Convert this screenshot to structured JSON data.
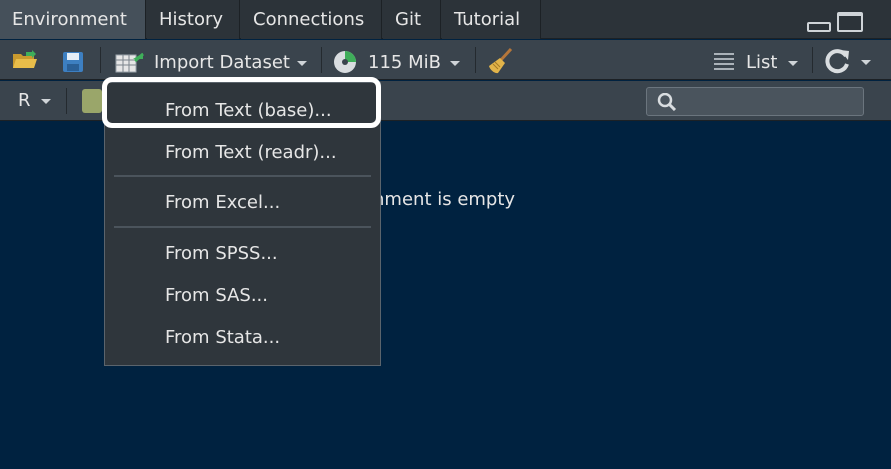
{
  "tabs": [
    {
      "label": "Environment",
      "active": true
    },
    {
      "label": "History"
    },
    {
      "label": "Connections"
    },
    {
      "label": "Git"
    },
    {
      "label": "Tutorial"
    }
  ],
  "toolbar": {
    "import_label": "Import Dataset",
    "memory_label": "115 MiB",
    "view_label": "List"
  },
  "toolbar2": {
    "language": "R",
    "search_placeholder": ""
  },
  "empty_message": "ronment is empty",
  "menu": {
    "items": [
      "From Text (base)...",
      "From Text (readr)...",
      "From Excel...",
      "From SPSS...",
      "From SAS...",
      "From Stata..."
    ],
    "highlighted": "From Text (base)..."
  },
  "colors": {
    "background": "#002240",
    "toolbar": "#3a444d",
    "menu": "#2f363c",
    "highlight": "#ffffff"
  },
  "icons": [
    "open-folder-icon",
    "save-icon",
    "import-table-icon",
    "memory-pie-icon",
    "broom-icon",
    "list-icon",
    "refresh-icon",
    "search-icon",
    "minimize-icon",
    "maximize-icon"
  ]
}
